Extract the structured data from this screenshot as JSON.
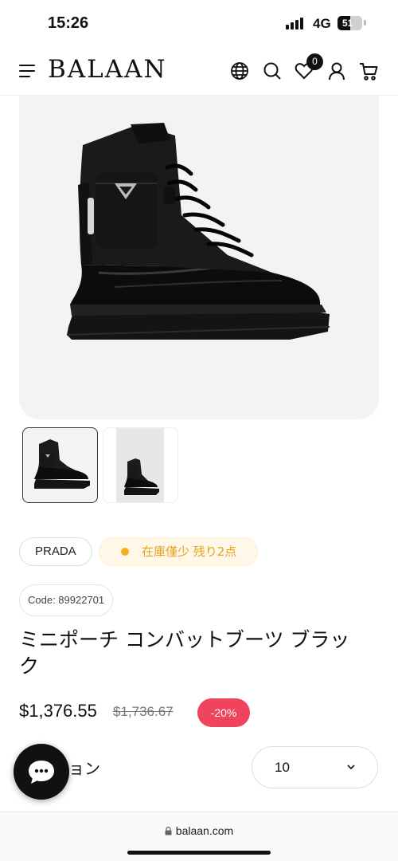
{
  "status_bar": {
    "time": "15:26",
    "network": "4G",
    "battery": "51",
    "battery_level_percent": 51
  },
  "header": {
    "logo": "BALAAN",
    "wishlist_count": "0",
    "icons": [
      "menu-icon",
      "globe-icon",
      "search-icon",
      "heart-icon",
      "user-icon",
      "cart-icon"
    ]
  },
  "gallery": {
    "main_image": "black-combat-boot-with-mini-pouch",
    "thumbnails": [
      "boot-thumbnail-1",
      "boot-thumbnail-2"
    ],
    "selected_index": 0
  },
  "product": {
    "brand": "PRADA",
    "stock_status": "在庫僅少 残り2点",
    "code": "Code: 89922701",
    "title": "ミニポーチ コンバットブーツ ブラック",
    "price": "$1,376.55",
    "original_price": "$1,736.67",
    "discount": "-20%"
  },
  "option": {
    "label_visible": "ョン",
    "selected_value": "10"
  },
  "browser": {
    "url": "balaan.com"
  },
  "colors": {
    "accent_discount": "#f0435e",
    "stock_text": "#e6a119",
    "stock_bg": "#fff8e8",
    "background": "#ffffff"
  }
}
